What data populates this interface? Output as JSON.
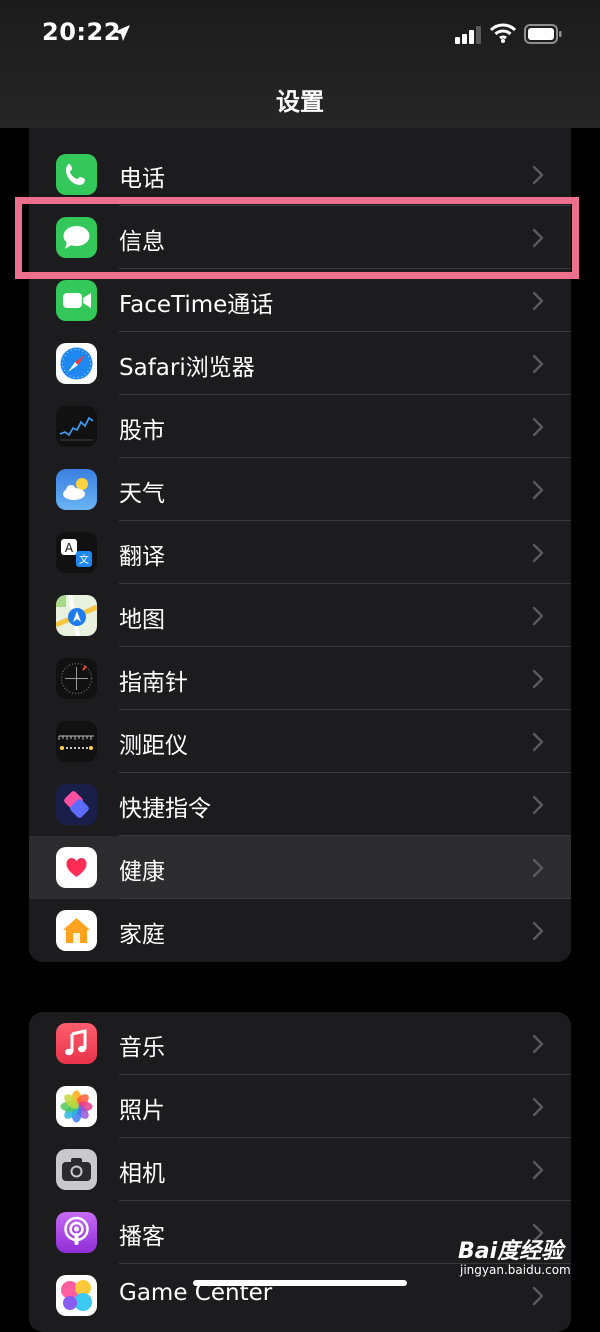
{
  "status": {
    "time": "20:22"
  },
  "nav": {
    "title": "设置"
  },
  "group1": [
    {
      "icon": "phone-icon",
      "label": "电话"
    },
    {
      "icon": "messages-icon",
      "label": "信息"
    },
    {
      "icon": "facetime-icon",
      "label": "FaceTime通话"
    },
    {
      "icon": "safari-icon",
      "label": "Safari浏览器"
    },
    {
      "icon": "stocks-icon",
      "label": "股市"
    },
    {
      "icon": "weather-icon",
      "label": "天气"
    },
    {
      "icon": "translate-icon",
      "label": "翻译"
    },
    {
      "icon": "maps-icon",
      "label": "地图"
    },
    {
      "icon": "compass-icon",
      "label": "指南针"
    },
    {
      "icon": "measure-icon",
      "label": "测距仪"
    },
    {
      "icon": "shortcuts-icon",
      "label": "快捷指令"
    },
    {
      "icon": "health-icon",
      "label": "健康"
    },
    {
      "icon": "home-app-icon",
      "label": "家庭"
    }
  ],
  "group2": [
    {
      "icon": "music-icon",
      "label": "音乐"
    },
    {
      "icon": "photos-icon",
      "label": "照片"
    },
    {
      "icon": "camera-icon",
      "label": "相机"
    },
    {
      "icon": "podcasts-icon",
      "label": "播客"
    },
    {
      "icon": "game-center-icon",
      "label": "Game Center"
    }
  ],
  "watermark": {
    "logo": "Bai度经验",
    "url": "jingyan.baidu.com"
  }
}
